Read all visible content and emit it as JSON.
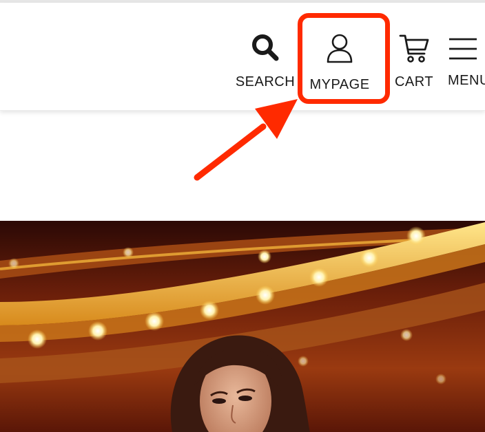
{
  "header": {
    "nav": {
      "search_label": "SEARCH",
      "mypage_label": "MYPAGE",
      "cart_label": "CART",
      "menu_label": "MENU"
    },
    "icons": [
      "search-icon",
      "user-icon",
      "cart-icon",
      "hamburger-menu-icon"
    ]
  },
  "annotation": {
    "highlight_color": "#ff2a00",
    "target": "mypage"
  },
  "hero": {
    "image": "theater-interior-woman-photo",
    "colors": {
      "balcony_glow": "#f5c542",
      "shadow": "#2a0a04"
    }
  }
}
